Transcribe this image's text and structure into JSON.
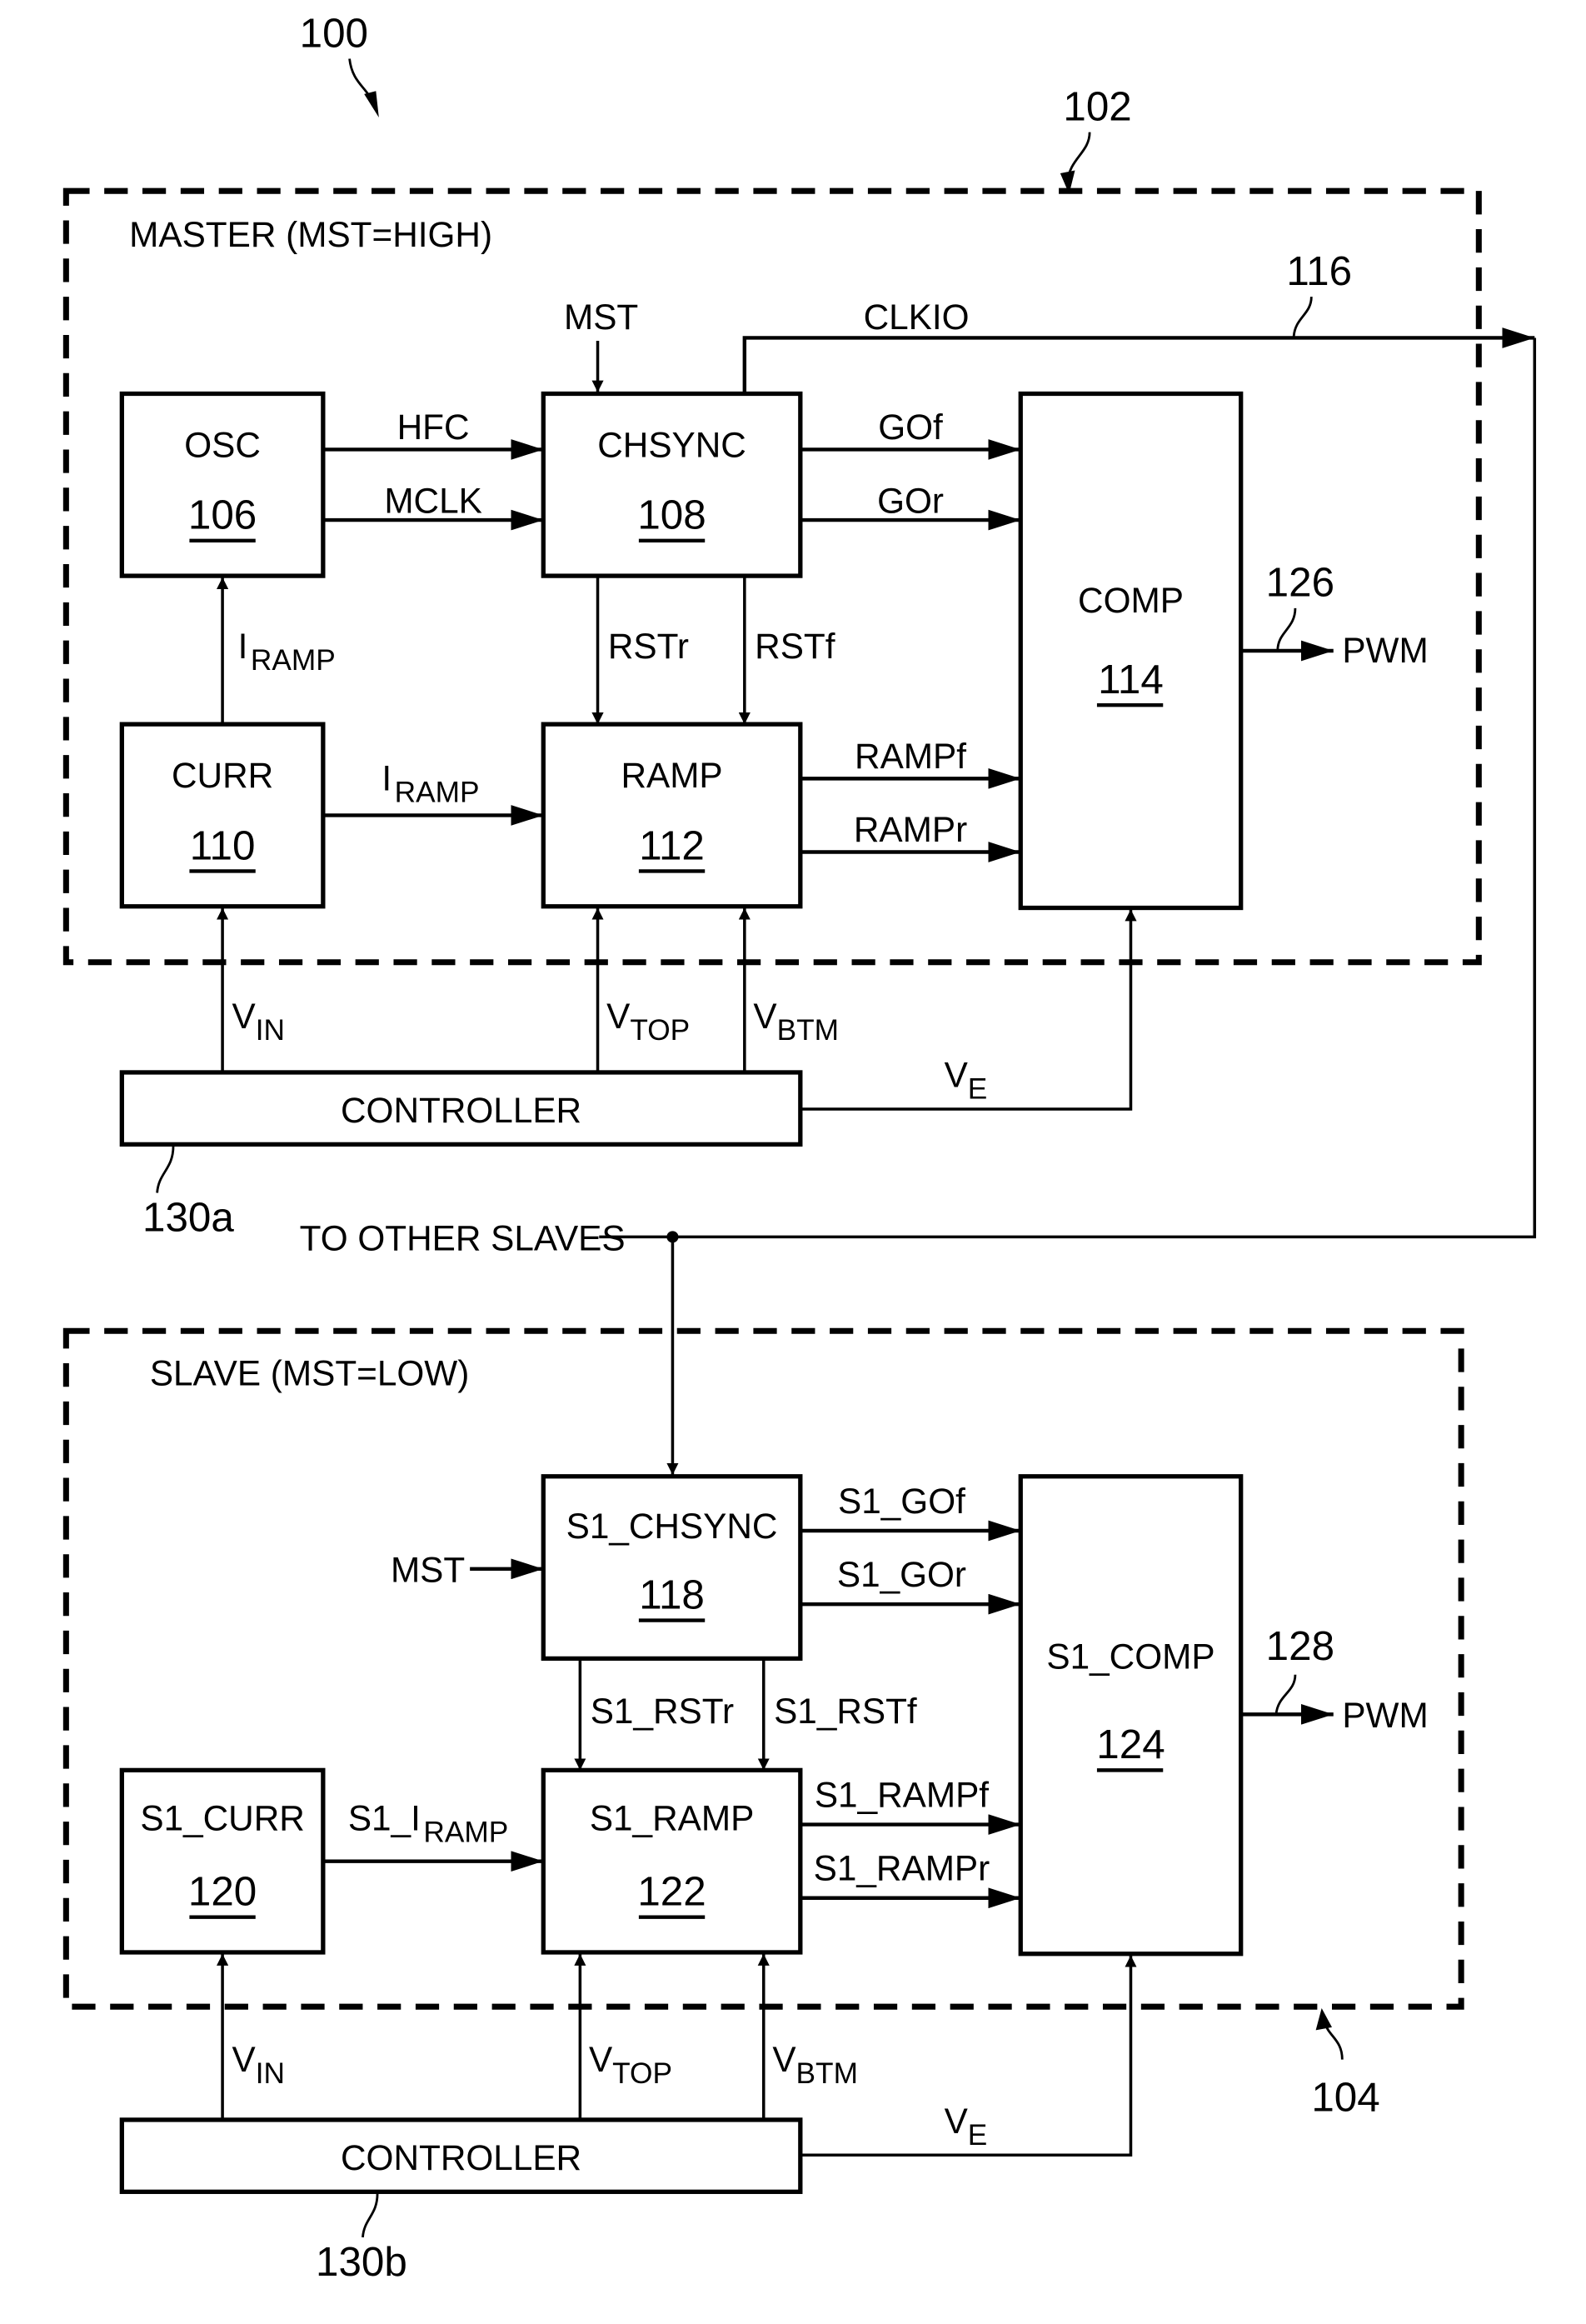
{
  "figure_ref": "100",
  "master": {
    "ref": "102",
    "title": "MASTER (MST=HIGH)",
    "blocks": {
      "osc": {
        "name": "OSC",
        "ref": "106"
      },
      "chsync": {
        "name": "CHSYNC",
        "ref": "108"
      },
      "curr": {
        "name": "CURR",
        "ref": "110"
      },
      "ramp": {
        "name": "RAMP",
        "ref": "112"
      },
      "comp": {
        "name": "COMP",
        "ref": "114"
      }
    },
    "signals": {
      "mst": "MST",
      "clkio": "CLKIO",
      "clkio_ref": "116",
      "hfc": "HFC",
      "mclk": "MCLK",
      "gof": "GOf",
      "gor": "GOr",
      "rstr": "RSTr",
      "rstf": "RSTf",
      "iramp_main": "I",
      "iramp_sub": "RAMP",
      "rampf": "RAMPf",
      "rampr": "RAMPr",
      "pwm": "PWM",
      "pwm_ref": "126"
    }
  },
  "controller_a": {
    "name": "CONTROLLER",
    "ref": "130a",
    "outputs": {
      "vin": {
        "main": "V",
        "sub": "IN"
      },
      "vtop": {
        "main": "V",
        "sub": "TOP"
      },
      "vbtm": {
        "main": "V",
        "sub": "BTM"
      },
      "ve": {
        "main": "V",
        "sub": "E"
      }
    }
  },
  "to_other_slaves": "TO OTHER SLAVES",
  "slave": {
    "ref": "104",
    "title": "SLAVE (MST=LOW)",
    "blocks": {
      "chsync": {
        "name": "S1_CHSYNC",
        "ref": "118"
      },
      "curr": {
        "name": "S1_CURR",
        "ref": "120"
      },
      "ramp": {
        "name": "S1_RAMP",
        "ref": "122"
      },
      "comp": {
        "name": "S1_COMP",
        "ref": "124"
      }
    },
    "signals": {
      "mst": "MST",
      "gof": "S1_GOf",
      "gor": "S1_GOr",
      "rstr": "S1_RSTr",
      "rstf": "S1_RSTf",
      "iramp_main": "S1_I",
      "iramp_sub": "RAMP",
      "rampf": "S1_RAMPf",
      "rampr": "S1_RAMPr",
      "pwm": "PWM",
      "pwm_ref": "128"
    }
  },
  "controller_b": {
    "name": "CONTROLLER",
    "ref": "130b",
    "outputs": {
      "vin": {
        "main": "V",
        "sub": "IN"
      },
      "vtop": {
        "main": "V",
        "sub": "TOP"
      },
      "vbtm": {
        "main": "V",
        "sub": "BTM"
      },
      "ve": {
        "main": "V",
        "sub": "E"
      }
    }
  }
}
